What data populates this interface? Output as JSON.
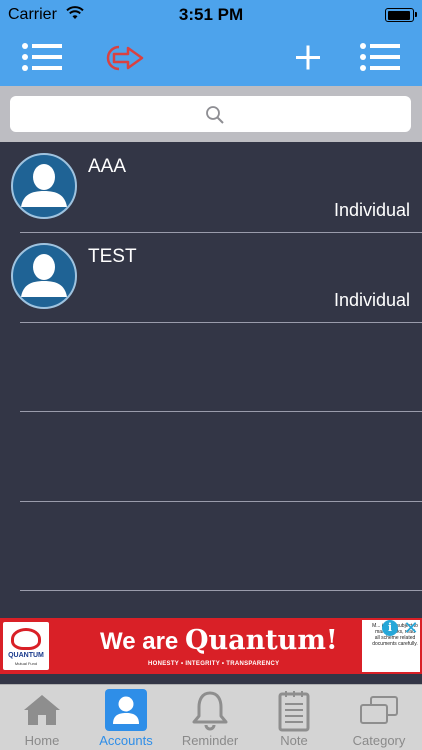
{
  "status_bar": {
    "carrier": "Carrier",
    "time": "3:51 PM",
    "battery_level": 0.95
  },
  "navbar": {
    "left_icon": "list-menu-icon",
    "logout_icon": "logout-arrow-icon",
    "add_icon": "plus-icon",
    "right_icon": "list-menu-icon"
  },
  "search": {
    "placeholder": "",
    "value": "",
    "icon": "magnifier-icon"
  },
  "accounts": [
    {
      "name": "AAA",
      "type": "Individual"
    },
    {
      "name": "TEST",
      "type": "Individual"
    }
  ],
  "ad": {
    "headline_prefix": "We are ",
    "headline_brand": "Quantum!",
    "tagline": "HONESTY • INTEGRITY • TRANSPARENCY",
    "logo_text": "QUANTUM",
    "logo_subtext": "Mutual Fund",
    "disclaimer": "M... inve... subject to market risks, read all scheme related documents carefully.",
    "info_icon": "info-icon",
    "close_icon": "close-icon"
  },
  "tabs": [
    {
      "label": "Home",
      "icon": "home-icon",
      "active": false
    },
    {
      "label": "Accounts",
      "icon": "person-icon",
      "active": true
    },
    {
      "label": "Reminder",
      "icon": "bell-icon",
      "active": false
    },
    {
      "label": "Note",
      "icon": "notepad-icon",
      "active": false
    },
    {
      "label": "Category",
      "icon": "stacked-windows-icon",
      "active": false
    }
  ],
  "colors": {
    "bar_blue": "#4da3ec",
    "list_background": "#333646",
    "active_tab": "#2e8ee8",
    "ad_red": "#d92027"
  }
}
